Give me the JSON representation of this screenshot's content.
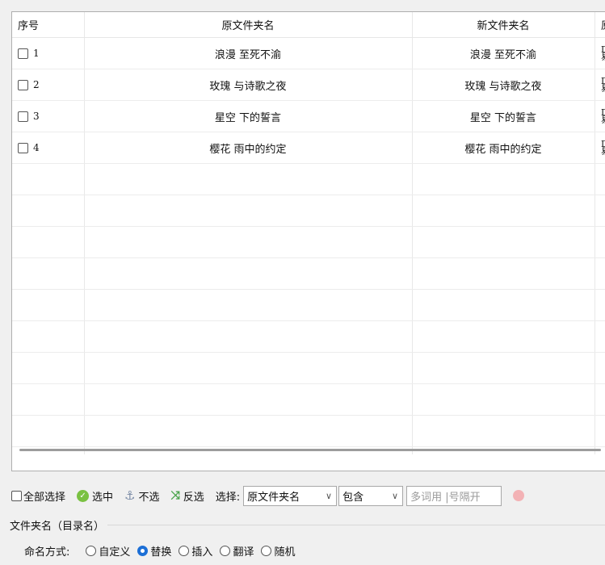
{
  "table": {
    "headers": [
      "序号",
      "原文件夹名",
      "新文件夹名",
      "原"
    ],
    "rows": [
      {
        "index": "1",
        "original": "浪漫 至死不渝",
        "new": "浪漫 至死不渝",
        "extra": "D\n易"
      },
      {
        "index": "2",
        "original": "玫瑰 与诗歌之夜",
        "new": "玫瑰 与诗歌之夜",
        "extra": "D\n易"
      },
      {
        "index": "3",
        "original": "星空 下的誓言",
        "new": "星空 下的誓言",
        "extra": "D\n易"
      },
      {
        "index": "4",
        "original": "樱花 雨中的约定",
        "new": "樱花 雨中的约定",
        "extra": "D\n易"
      }
    ]
  },
  "toolbar": {
    "select_all_label": "全部选择",
    "select_label": "选中",
    "deselect_label": "不选",
    "invert_label": "反选",
    "choose_label": "选择:",
    "field_select_value": "原文件夹名",
    "match_select_value": "包含",
    "keyword_placeholder": "多词用 |号隔开"
  },
  "group": {
    "title": "文件夹名（目录名）",
    "mode_label": "命名方式:",
    "options": [
      {
        "label": "自定义",
        "selected": false
      },
      {
        "label": "替换",
        "selected": true
      },
      {
        "label": "插入",
        "selected": false
      },
      {
        "label": "翻译",
        "selected": false
      },
      {
        "label": "随机",
        "selected": false
      }
    ]
  },
  "icons": {
    "select": "check-circle-icon",
    "deselect": "anchor-icon",
    "invert": "shuffle-icon",
    "extra": "pink-blob-icon"
  },
  "colors": {
    "radio_selected": "#1c6fd6",
    "check_green": "#7ac142",
    "invert_green": "#49a34b"
  }
}
